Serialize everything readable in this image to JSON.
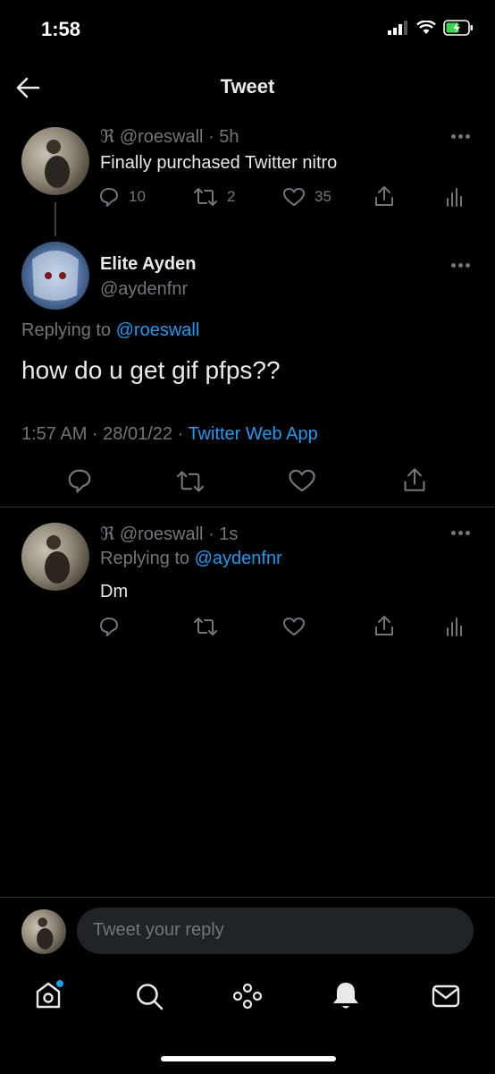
{
  "status_bar": {
    "time": "1:58"
  },
  "header": {
    "title": "Tweet"
  },
  "tweet1": {
    "handle": "ℜ @roeswall",
    "time": "· 5h",
    "text": "Finally purchased Twitter nitro",
    "replies": "10",
    "retweets": "2",
    "likes": "35"
  },
  "main_tweet": {
    "display_name": "Elite Ayden",
    "handle": "@aydenfnr",
    "replying_prefix": "Replying to",
    "replying_to": "@roeswall",
    "text": "how do u get gif pfps??",
    "timestamp": "1:57 AM · 28/01/22 ·",
    "source": "Twitter Web App"
  },
  "tweet3": {
    "handle": "ℜ @roeswall",
    "time": "· 1s",
    "replying_prefix": "Replying to",
    "replying_to": "@aydenfnr",
    "text": "Dm"
  },
  "composer": {
    "placeholder": "Tweet your reply"
  },
  "colors": {
    "background": "#000000",
    "accent": "#1d9bf0",
    "muted": "#71767b",
    "text": "#e7e9ea"
  },
  "nav_icons": [
    "home-icon",
    "search-icon",
    "spaces-icon",
    "notifications-icon",
    "messages-icon"
  ]
}
